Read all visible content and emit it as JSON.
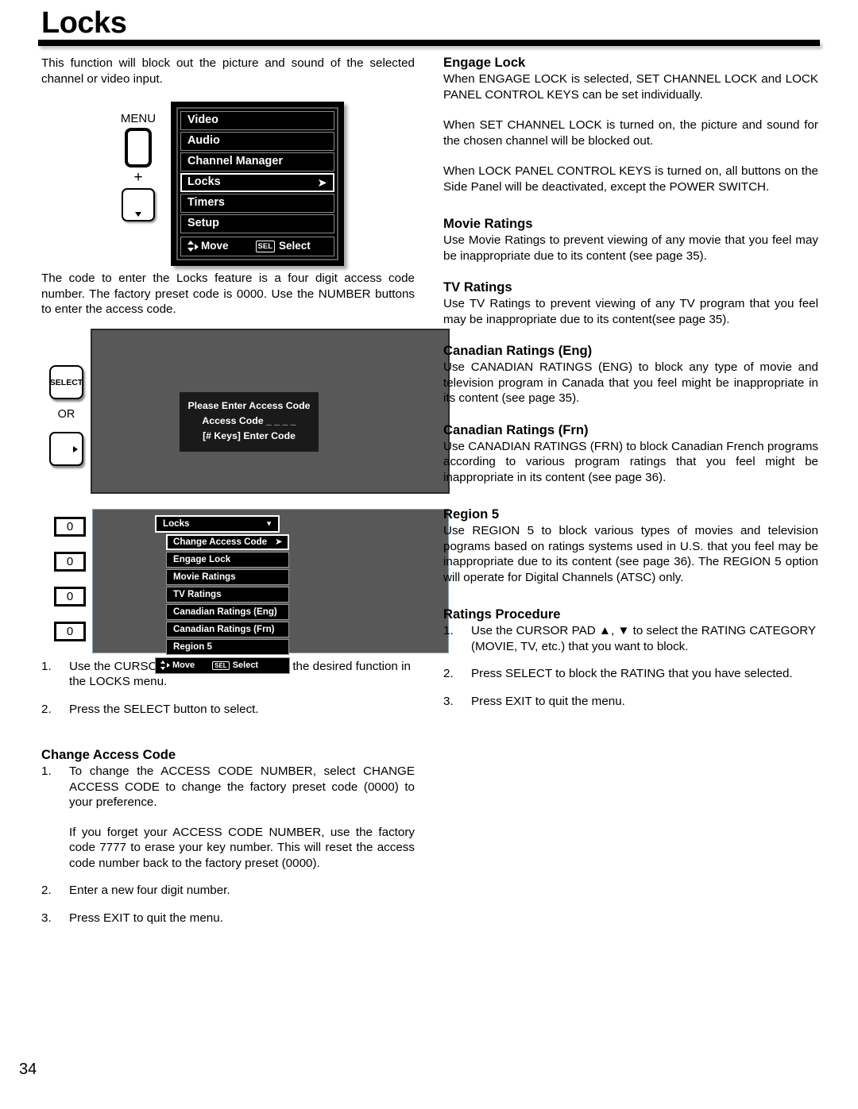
{
  "page": {
    "title": "Locks",
    "number": "34"
  },
  "left": {
    "intro": "This function will block out the picture and sound of the selected channel or video input.",
    "code_paragraph": "The code to enter the Locks feature is a four digit access code number. The factory preset code is 0000. Use the NUMBER buttons to enter the access code.",
    "steps": [
      {
        "num": "1.",
        "text": "Use the CURSOR PAD ▲, ▼ to highlight the desired function in the LOCKS menu."
      },
      {
        "num": "2.",
        "text": "Press the SELECT button to select."
      }
    ],
    "change_access_code": {
      "heading": "Change Access Code",
      "steps": [
        {
          "num": "1.",
          "text": "To change the ACCESS CODE NUMBER, select CHANGE ACCESS CODE to change the factory preset code (0000) to your preference.",
          "text2": "If you forget your ACCESS CODE NUMBER, use the factory code 7777 to erase your key number. This will reset the access code number back to the factory preset (0000)."
        },
        {
          "num": "2.",
          "text": "Enter a new four digit number."
        },
        {
          "num": "3.",
          "text": "Press EXIT to quit the menu."
        }
      ]
    }
  },
  "right": {
    "sections": [
      {
        "heading": "Engage Lock",
        "paragraphs": [
          "When ENGAGE LOCK is selected, SET CHANNEL LOCK and LOCK PANEL CONTROL KEYS can be set individually.",
          "When SET CHANNEL LOCK is turned on, the picture and sound for the chosen channel will be blocked out.",
          "When LOCK PANEL CONTROL KEYS is turned on, all buttons on the Side Panel will be deactivated, except the POWER SWITCH."
        ]
      },
      {
        "heading": "Movie Ratings",
        "paragraphs": [
          "Use Movie Ratings to prevent viewing of any movie that you feel may be inappropriate due to its content (see page 35)."
        ]
      },
      {
        "heading": "TV Ratings",
        "paragraphs": [
          "Use TV Ratings to prevent viewing of any TV program that you feel may be inappropriate due to its content(see page 35)."
        ]
      },
      {
        "heading": "Canadian Ratings (Eng)",
        "paragraphs": [
          "Use CANADIAN RATINGS (ENG) to block any type of movie and television program in Canada that you feel might be inappropriate in its content (see page 35)."
        ]
      },
      {
        "heading": "Canadian Ratings (Frn)",
        "paragraphs": [
          "Use CANADIAN RATINGS (FRN) to block Canadian French programs according to various program ratings that you feel might be inappropriate in its content (see page 36)."
        ]
      },
      {
        "heading": "Region 5",
        "paragraphs": [
          "Use REGION 5 to block various types of movies and television pograms based on ratings systems used in U.S. that you feel may be inappropriate due to its content (see page 36). The REGION 5 option will operate for Digital Channels (ATSC) only."
        ]
      }
    ],
    "ratings_procedure": {
      "heading": "Ratings Procedure",
      "steps": [
        {
          "num": "1.",
          "text": "Use the CURSOR PAD ▲, ▼ to select the RATING CATEGORY (MOVIE, TV, etc.) that you want to block."
        },
        {
          "num": "2.",
          "text": "Press SELECT to block the RATING that you have selected."
        },
        {
          "num": "3.",
          "text": "Press EXIT to quit the menu."
        }
      ]
    }
  },
  "main_menu_figure": {
    "remote_label": "MENU",
    "plus": "+",
    "items": [
      {
        "label": "Video",
        "selected": false,
        "arrow": ""
      },
      {
        "label": "Audio",
        "selected": false,
        "arrow": ""
      },
      {
        "label": "Channel Manager",
        "selected": false,
        "arrow": ""
      },
      {
        "label": "Locks",
        "selected": true,
        "arrow": "➤"
      },
      {
        "label": "Timers",
        "selected": false,
        "arrow": ""
      },
      {
        "label": "Setup",
        "selected": false,
        "arrow": ""
      }
    ],
    "footer": {
      "move_label": "Move",
      "sel_key": "SEL",
      "select_label": "Select"
    }
  },
  "access_code_figure": {
    "select_button": "SELECT",
    "or_label": "OR",
    "dialog": {
      "line1": "Please Enter Access Code",
      "line2": "Access Code  _ _ _ _",
      "line3": "[# Keys] Enter Code"
    }
  },
  "locks_menu_figure": {
    "number_keys": [
      "0",
      "0",
      "0",
      "0"
    ],
    "header": {
      "label": "Locks",
      "chevron": "▼"
    },
    "items": [
      {
        "label": "Change Access Code",
        "selected": true,
        "arrow": "➤"
      },
      {
        "label": "Engage Lock",
        "selected": false,
        "arrow": ""
      },
      {
        "label": "Movie Ratings",
        "selected": false,
        "arrow": ""
      },
      {
        "label": "TV Ratings",
        "selected": false,
        "arrow": ""
      },
      {
        "label": "Canadian Ratings (Eng)",
        "selected": false,
        "arrow": ""
      },
      {
        "label": "Canadian Ratings (Frn)",
        "selected": false,
        "arrow": ""
      },
      {
        "label": "Region 5",
        "selected": false,
        "arrow": ""
      }
    ],
    "footer": {
      "move_label": "Move",
      "sel_key": "SEL",
      "select_label": "Select"
    }
  }
}
